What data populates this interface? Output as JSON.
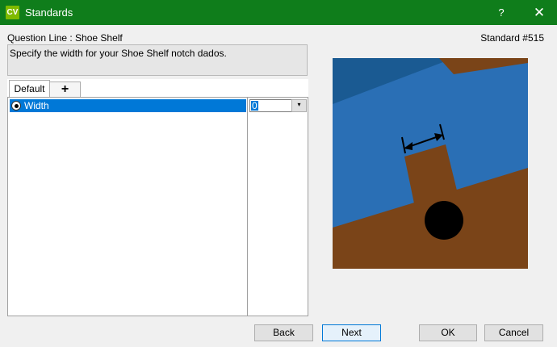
{
  "window": {
    "app_icon_text": "CV",
    "title": "Standards",
    "help_label": "?",
    "close_label": "✕"
  },
  "header": {
    "question_line": "Question Line : Shoe Shelf",
    "standard_number": "Standard #515"
  },
  "description": "Specify the width for your Shoe Shelf notch dados.",
  "tabs": [
    {
      "label": "Default"
    },
    {
      "label": "+"
    }
  ],
  "properties": [
    {
      "label": "Width",
      "value": "0"
    }
  ],
  "spin_symbol": "▾",
  "buttons": {
    "back": "Back",
    "next": "Next",
    "ok": "OK",
    "cancel": "Cancel"
  },
  "colors": {
    "titlebar": "#0f7d1b",
    "selection": "#0078d7",
    "board_blue": "#2a6fb5",
    "board_dark_blue": "#1a5a92",
    "material_brown": "#7a4418",
    "hole_black": "#000000"
  },
  "preview_icon": "shoe-shelf-notch-dado-diagram"
}
